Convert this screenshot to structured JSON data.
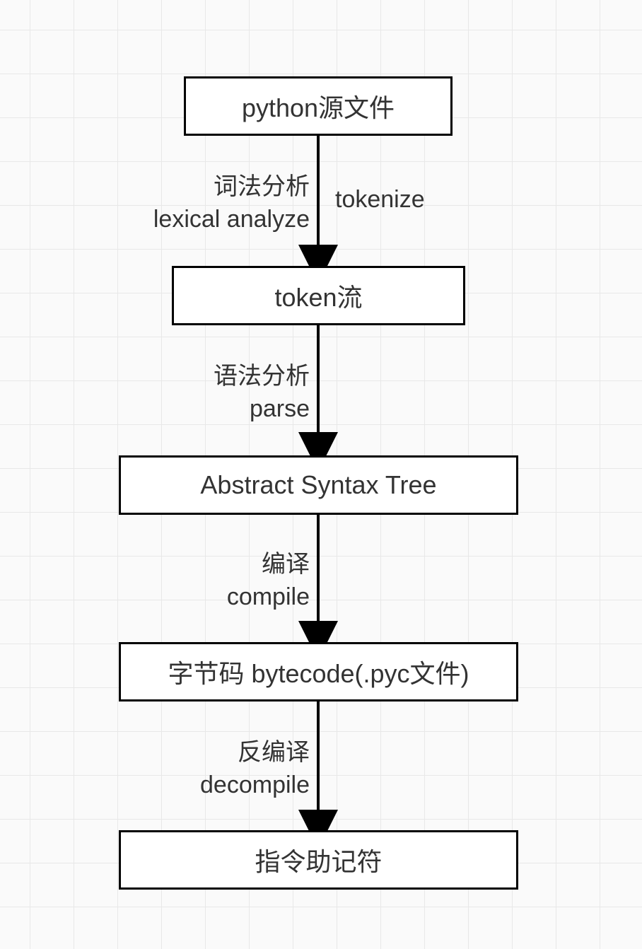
{
  "nodes": {
    "source": "python源文件",
    "tokens": "token流",
    "ast": "Abstract Syntax Tree",
    "bytecode": "字节码 bytecode(.pyc文件)",
    "mnemonics": "指令助记符"
  },
  "edges": {
    "e1_left_line1": "词法分析",
    "e1_left_line2": "lexical analyze",
    "e1_right": "tokenize",
    "e2_line1": "语法分析",
    "e2_line2": "parse",
    "e3_line1": "编译",
    "e3_line2": "compile",
    "e4_line1": "反编译",
    "e4_line2": "decompile"
  }
}
